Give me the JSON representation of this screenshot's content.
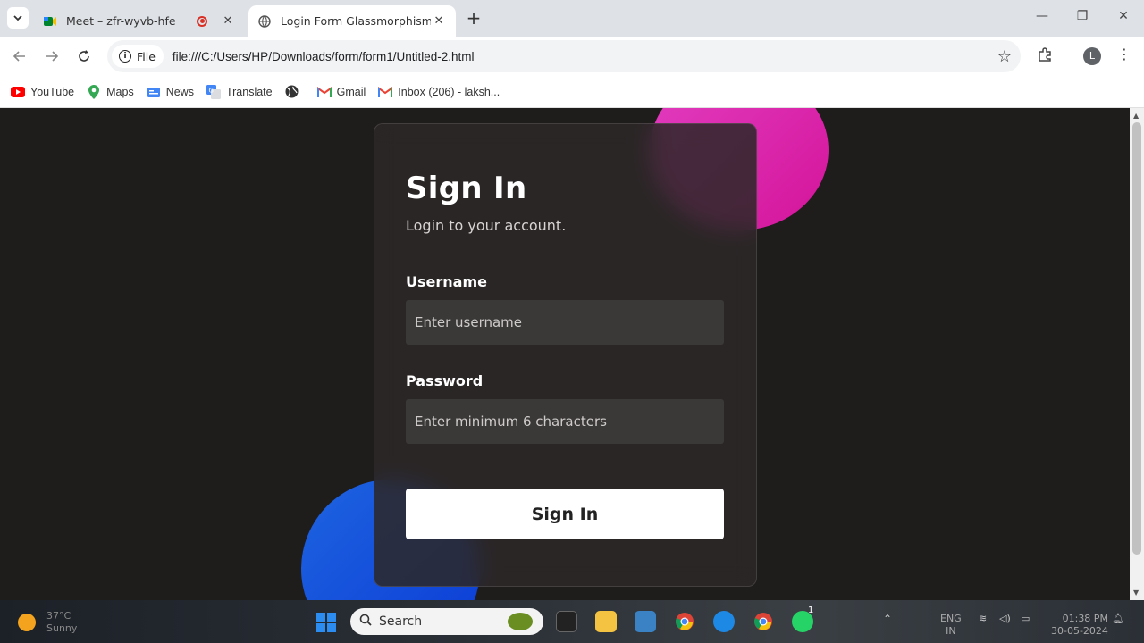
{
  "tabs": [
    {
      "title": "Meet – zfr-wyvb-hfe",
      "active": false
    },
    {
      "title": "Login Form Glassmorphism",
      "active": true
    }
  ],
  "toolbar": {
    "chip_label": "File",
    "url": "file:///C:/Users/HP/Downloads/form/form1/Untitled-2.html",
    "profile_initial": "L"
  },
  "bookmarks": [
    {
      "label": "YouTube",
      "icon": "youtube-icon"
    },
    {
      "label": "Maps",
      "icon": "maps-icon"
    },
    {
      "label": "News",
      "icon": "news-icon"
    },
    {
      "label": "Translate",
      "icon": "translate-icon"
    },
    {
      "label": "",
      "icon": "globe-icon"
    },
    {
      "label": "Gmail",
      "icon": "gmail-icon"
    },
    {
      "label": "Inbox (206) - laksh...",
      "icon": "gmail-icon"
    }
  ],
  "form": {
    "title": "Sign In",
    "subtitle": "Login to your account.",
    "username_label": "Username",
    "username_placeholder": "Enter username",
    "password_label": "Password",
    "password_placeholder": "Enter minimum 6 characters",
    "submit_label": "Sign In"
  },
  "taskbar": {
    "weather_temp": "37°C",
    "weather_desc": "Sunny",
    "search_label": "Search",
    "lang_line1": "ENG",
    "lang_line2": "IN",
    "time": "01:38 PM",
    "date": "30-05-2024",
    "whatsapp_badge": "1"
  },
  "colors": {
    "page_bg": "#1f1c1c",
    "card_bg": "#2c2828",
    "pink_blob": "#e23ec0",
    "blue_blob": "#1e64e0",
    "button_bg": "#ffffff"
  }
}
